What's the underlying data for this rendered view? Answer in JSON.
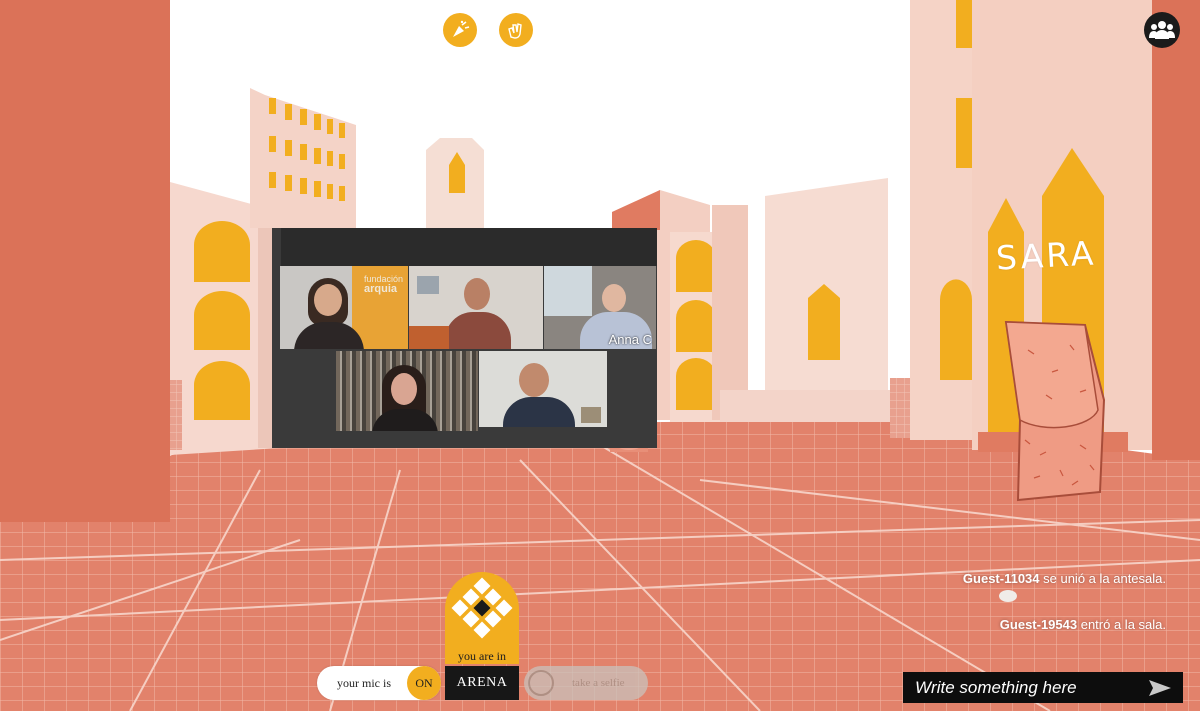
{
  "toolbar": {
    "confetti_icon": "party-popper-icon",
    "applause_icon": "clapping-hands-icon",
    "people_icon": "people-group-icon"
  },
  "video_wall": {
    "brand_line1": "fundación",
    "brand_line2": "arquia",
    "participant_name": "Anna C"
  },
  "avatar": {
    "name": "SARA"
  },
  "chat": {
    "messages": [
      {
        "user": "Guest-11034",
        "text": " se unió a la antesala."
      },
      {
        "user": "Guest-19543",
        "text": " entró a la sala."
      }
    ],
    "input_placeholder": "Write something here",
    "send_icon": "send-arrow-icon"
  },
  "controls": {
    "mic_label": "your mic is",
    "mic_state": "ON",
    "location_label": "you are in",
    "room_name": "ARENA",
    "selfie_label": "take a selfie"
  },
  "colors": {
    "accent": "#f2ae1f",
    "terracotta": "#db7258",
    "floor": "#e48f7b",
    "dark": "#171717"
  }
}
